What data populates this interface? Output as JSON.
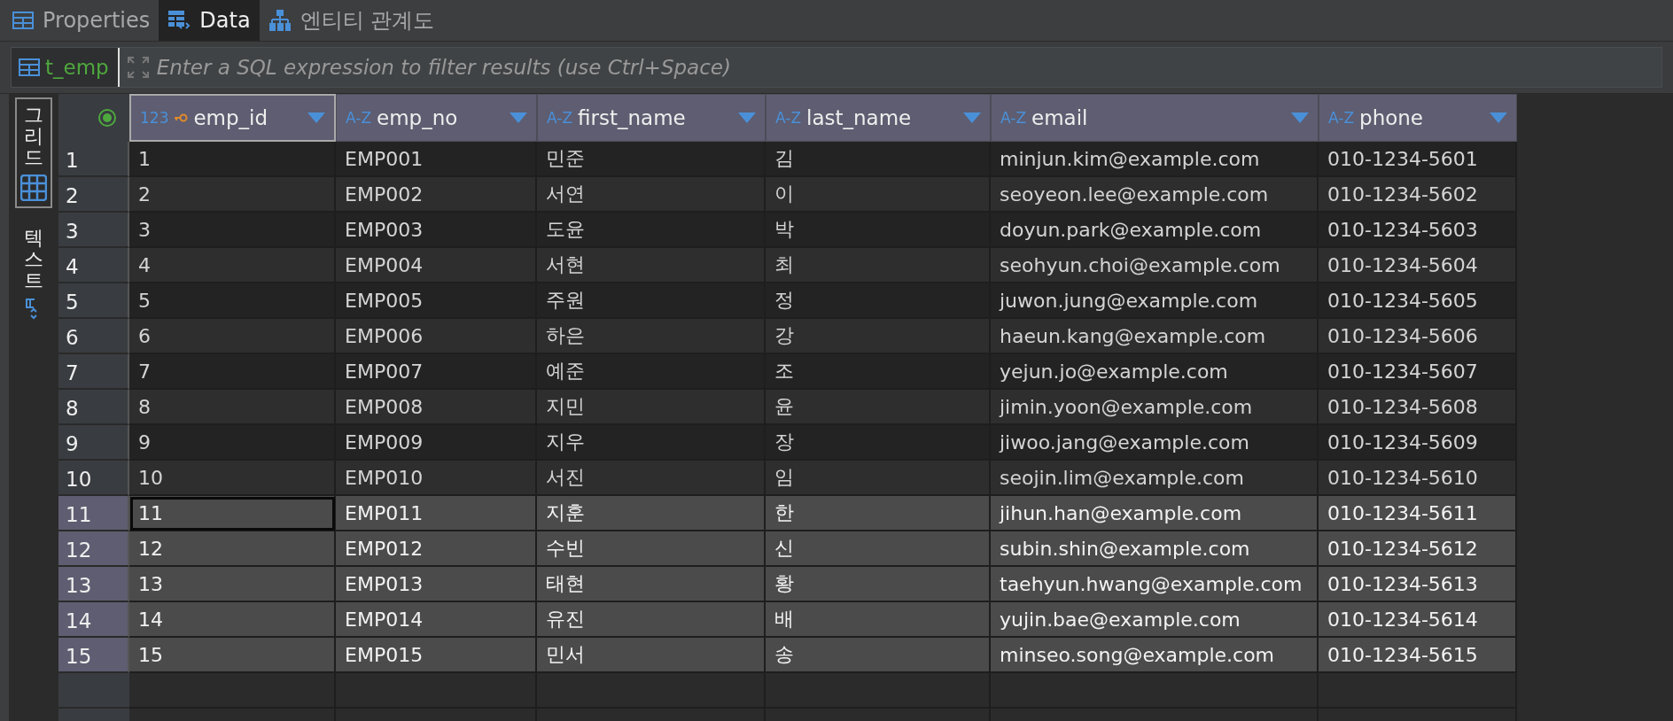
{
  "tabs": [
    {
      "label": "Properties",
      "kind": "properties",
      "selected": false
    },
    {
      "label": "Data",
      "kind": "data",
      "selected": true
    },
    {
      "label": "엔티티 관계도",
      "kind": "diagram",
      "selected": false
    }
  ],
  "filter": {
    "table": "t_emp",
    "placeholder": "Enter a SQL expression to filter results (use Ctrl+Space)"
  },
  "side_tabs": [
    {
      "label": "그리드",
      "kind": "grid",
      "selected": true
    },
    {
      "label": "텍스트",
      "kind": "text",
      "selected": false
    }
  ],
  "columns": [
    {
      "name": "emp_id",
      "type": "123",
      "key": true,
      "focused": true
    },
    {
      "name": "emp_no",
      "type": "A-Z",
      "key": false,
      "focused": false
    },
    {
      "name": "first_name",
      "type": "A-Z",
      "key": false,
      "focused": false
    },
    {
      "name": "last_name",
      "type": "A-Z",
      "key": false,
      "focused": false
    },
    {
      "name": "email",
      "type": "A-Z",
      "key": false,
      "focused": false
    },
    {
      "name": "phone",
      "type": "A-Z",
      "key": false,
      "focused": false
    }
  ],
  "rows": [
    {
      "number": "1",
      "selected": false,
      "focused": false,
      "cells": [
        "1",
        "EMP001",
        "민준",
        "김",
        "minjun.kim@example.com",
        "010-1234-5601"
      ]
    },
    {
      "number": "2",
      "selected": false,
      "focused": false,
      "cells": [
        "2",
        "EMP002",
        "서연",
        "이",
        "seoyeon.lee@example.com",
        "010-1234-5602"
      ]
    },
    {
      "number": "3",
      "selected": false,
      "focused": false,
      "cells": [
        "3",
        "EMP003",
        "도윤",
        "박",
        "doyun.park@example.com",
        "010-1234-5603"
      ]
    },
    {
      "number": "4",
      "selected": false,
      "focused": false,
      "cells": [
        "4",
        "EMP004",
        "서현",
        "최",
        "seohyun.choi@example.com",
        "010-1234-5604"
      ]
    },
    {
      "number": "5",
      "selected": false,
      "focused": false,
      "cells": [
        "5",
        "EMP005",
        "주원",
        "정",
        "juwon.jung@example.com",
        "010-1234-5605"
      ]
    },
    {
      "number": "6",
      "selected": false,
      "focused": false,
      "cells": [
        "6",
        "EMP006",
        "하은",
        "강",
        "haeun.kang@example.com",
        "010-1234-5606"
      ]
    },
    {
      "number": "7",
      "selected": false,
      "focused": false,
      "cells": [
        "7",
        "EMP007",
        "예준",
        "조",
        "yejun.jo@example.com",
        "010-1234-5607"
      ]
    },
    {
      "number": "8",
      "selected": false,
      "focused": false,
      "cells": [
        "8",
        "EMP008",
        "지민",
        "윤",
        "jimin.yoon@example.com",
        "010-1234-5608"
      ]
    },
    {
      "number": "9",
      "selected": false,
      "focused": false,
      "cells": [
        "9",
        "EMP009",
        "지우",
        "장",
        "jiwoo.jang@example.com",
        "010-1234-5609"
      ]
    },
    {
      "number": "10",
      "selected": false,
      "focused": false,
      "cells": [
        "10",
        "EMP010",
        "서진",
        "임",
        "seojin.lim@example.com",
        "010-1234-5610"
      ]
    },
    {
      "number": "11",
      "selected": true,
      "focused": true,
      "cells": [
        "11",
        "EMP011",
        "지훈",
        "한",
        "jihun.han@example.com",
        "010-1234-5611"
      ]
    },
    {
      "number": "12",
      "selected": true,
      "focused": false,
      "cells": [
        "12",
        "EMP012",
        "수빈",
        "신",
        "subin.shin@example.com",
        "010-1234-5612"
      ]
    },
    {
      "number": "13",
      "selected": true,
      "focused": false,
      "cells": [
        "13",
        "EMP013",
        "태현",
        "황",
        "taehyun.hwang@example.com",
        "010-1234-5613"
      ]
    },
    {
      "number": "14",
      "selected": true,
      "focused": false,
      "cells": [
        "14",
        "EMP014",
        "유진",
        "배",
        "yujin.bae@example.com",
        "010-1234-5614"
      ]
    },
    {
      "number": "15",
      "selected": true,
      "focused": false,
      "cells": [
        "15",
        "EMP015",
        "민서",
        "송",
        "minseo.song@example.com",
        "010-1234-5615"
      ]
    }
  ]
}
